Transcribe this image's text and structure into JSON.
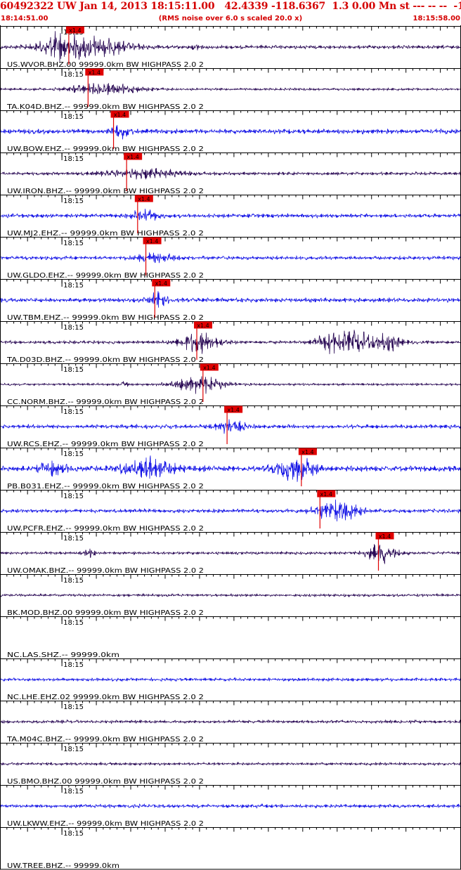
{
  "header": {
    "title": "60492322 UW Jan 14, 2013 18:15:11.00   42.4339 -118.6367  1.3 0.00 Mn st --- -- --  -1",
    "start_time": "18:14:51.00",
    "rms_note": "(RMS noise over 6.0 s scaled 20.0 x)",
    "end_time": "18:15:58.00"
  },
  "colors": {
    "header_text": "#d40000",
    "trace_dark": "#2a0a55",
    "trace_blue": "#1414e6",
    "pick_marker": "#e00000",
    "pick_label_bg": "#e00000"
  },
  "chart_data": {
    "type": "seismogram",
    "time_axis": {
      "start": "18:14:51.00",
      "end": "18:15:58.00",
      "duration_s": 67,
      "minute_mark": "18:15",
      "minute_mark_offset_s": 9
    },
    "pick_label": "x1.4",
    "channels": [
      {
        "label": "US.WVOR.BHZ.00 99999.0km BW  HIGHPASS  2.0  2",
        "color": "dark",
        "pick_s": 10.0,
        "amplitude": 0.9,
        "events": [
          {
            "t": 12.5,
            "w": 4.0,
            "a": 2.6
          },
          {
            "t": 8.5,
            "w": 1.5,
            "a": 1.8
          },
          {
            "t": 28.5,
            "w": 0.6,
            "a": 0.5
          }
        ]
      },
      {
        "label": "TA.K04D.BHZ.-- 99999.0km BW  HIGHPASS  2.0  2",
        "color": "dark",
        "pick_s": 12.8,
        "amplitude": 0.6,
        "events": [
          {
            "t": 15.0,
            "w": 3.5,
            "a": 1.3
          }
        ]
      },
      {
        "label": "UW.BOW.EHZ.-- 99999.0km BW  HIGHPASS  2.0  2",
        "color": "blue",
        "pick_s": 16.5,
        "amplitude": 1.2,
        "events": [
          {
            "t": 17.5,
            "w": 1.0,
            "a": 1.4
          }
        ]
      },
      {
        "label": "UW.IRON.BHZ.-- 99999.0km BW  HIGHPASS  2.0  2",
        "color": "dark",
        "pick_s": 18.4,
        "amplitude": 0.8,
        "events": [
          {
            "t": 21.0,
            "w": 4.0,
            "a": 1.1
          }
        ]
      },
      {
        "label": "UW.MJ2.EHZ.-- 99999.0km BW  HIGHPASS  2.0  2",
        "color": "blue",
        "pick_s": 20.0,
        "amplitude": 1.0,
        "events": [
          {
            "t": 21.0,
            "w": 1.5,
            "a": 1.3
          }
        ]
      },
      {
        "label": "UW.GLDO.EHZ.-- 99999.0km BW  HIGHPASS  2.0  2",
        "color": "blue",
        "pick_s": 21.2,
        "amplitude": 0.9,
        "events": [
          {
            "t": 22.5,
            "w": 2.0,
            "a": 1.0
          }
        ]
      },
      {
        "label": "UW.TBM.EHZ.-- 99999.0km BW  HIGHPASS  2.0  2",
        "color": "blue",
        "pick_s": 22.5,
        "amplitude": 1.1,
        "events": [
          {
            "t": 23.0,
            "w": 0.8,
            "a": 1.8
          }
        ]
      },
      {
        "label": "TA.D03D.BHZ.-- 99999.0km BW  HIGHPASS  2.0  2",
        "color": "dark",
        "pick_s": 28.6,
        "amplitude": 0.8,
        "events": [
          {
            "t": 29.0,
            "w": 2.0,
            "a": 2.3
          },
          {
            "t": 51.5,
            "w": 2.5,
            "a": 2.4
          },
          {
            "t": 56.5,
            "w": 1.2,
            "a": 1.8
          },
          {
            "t": 47.5,
            "w": 1.2,
            "a": 1.5
          }
        ]
      },
      {
        "label": "CC.NORM.BHZ.-- 99999.0km BW  HIGHPASS  2.0  2",
        "color": "dark",
        "pick_s": 29.5,
        "amplitude": 0.6,
        "events": [
          {
            "t": 29.0,
            "w": 2.5,
            "a": 2.0
          },
          {
            "t": 18.0,
            "w": 0.4,
            "a": 0.6
          }
        ]
      },
      {
        "label": "UW.RCS.EHZ.-- 99999.0km BW  HIGHPASS  2.0  2",
        "color": "blue",
        "pick_s": 33.0,
        "amplitude": 1.0,
        "events": [
          {
            "t": 33.5,
            "w": 1.5,
            "a": 1.6
          }
        ]
      },
      {
        "label": "PB.B031.EHZ.-- 99999.0km BW  HIGHPASS  2.0  2",
        "color": "blue",
        "pick_s": 43.8,
        "amplitude": 1.5,
        "events": [
          {
            "t": 21.5,
            "w": 2.5,
            "a": 2.2
          },
          {
            "t": 43.0,
            "w": 2.0,
            "a": 2.4
          },
          {
            "t": 7.5,
            "w": 1.5,
            "a": 1.3
          }
        ]
      },
      {
        "label": "UW.PCFR.EHZ.-- 99999.0km BW  HIGHPASS  2.0  2",
        "color": "blue",
        "pick_s": 46.5,
        "amplitude": 1.0,
        "events": [
          {
            "t": 49.0,
            "w": 2.0,
            "a": 2.8
          }
        ]
      },
      {
        "label": "UW.OMAK.BHZ.-- 99999.0km BW  HIGHPASS  2.0  2",
        "color": "dark",
        "pick_s": 55.0,
        "amplitude": 0.7,
        "events": [
          {
            "t": 55.5,
            "w": 1.5,
            "a": 2.3
          },
          {
            "t": 13.0,
            "w": 0.5,
            "a": 0.9
          }
        ]
      },
      {
        "label": "BK.MOD.BHZ.00 99999.0km BW  HIGHPASS  2.0  2",
        "color": "dark",
        "pick_s": null,
        "amplitude": 0.7,
        "events": []
      },
      {
        "label": "NC.LAS.SHZ.-- 99999.0km",
        "color": "none",
        "pick_s": null,
        "amplitude": 0,
        "events": []
      },
      {
        "label": "NC.LHE.EHZ.02 99999.0km BW  HIGHPASS  2.0  2",
        "color": "blue",
        "pick_s": null,
        "amplitude": 0.8,
        "events": []
      },
      {
        "label": "TA.M04C.BHZ.-- 99999.0km BW  HIGHPASS  2.0  2",
        "color": "dark",
        "pick_s": null,
        "amplitude": 0.8,
        "events": []
      },
      {
        "label": "US.BMO.BHZ.00 99999.0km BW  HIGHPASS  2.0  2",
        "color": "dark",
        "pick_s": null,
        "amplitude": 0.7,
        "events": []
      },
      {
        "label": "UW.LKWW.EHZ.-- 99999.0km BW  HIGHPASS  2.0  2",
        "color": "blue",
        "pick_s": null,
        "amplitude": 0.9,
        "events": []
      },
      {
        "label": "UW.TREE.BHZ.-- 99999.0km",
        "color": "none",
        "pick_s": null,
        "amplitude": 0,
        "events": []
      }
    ]
  }
}
